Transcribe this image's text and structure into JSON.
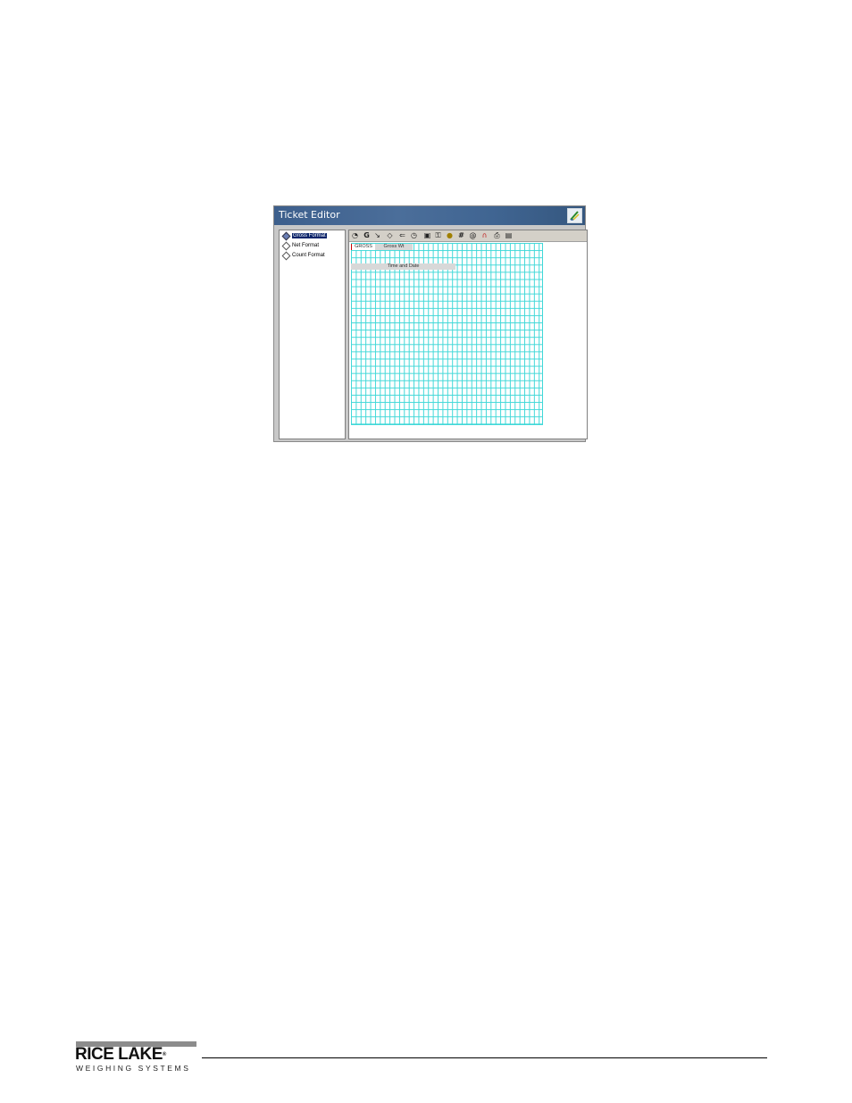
{
  "window": {
    "title": "Ticket Editor"
  },
  "tree": {
    "items": [
      {
        "label": "Gross Format",
        "selected": true
      },
      {
        "label": "Net Format",
        "selected": false
      },
      {
        "label": "Count Format",
        "selected": false
      }
    ]
  },
  "toolbar": {
    "icons": [
      "format-icon",
      "gross-icon",
      "net-icon",
      "diamond-icon",
      "arrow-icon",
      "clock-icon",
      "save-icon",
      "key-icon",
      "id-icon",
      "hash-icon",
      "at-icon",
      "magnet-icon",
      "print-icon",
      "help-icon"
    ]
  },
  "fields": {
    "gross_label": "GROSS",
    "gross_wt": "Gross Wt",
    "time_date": "Time and Date"
  },
  "footer": {
    "logo_main": "RICE LAKE",
    "logo_sub": "WEIGHING SYSTEMS",
    "trademark": "®"
  }
}
